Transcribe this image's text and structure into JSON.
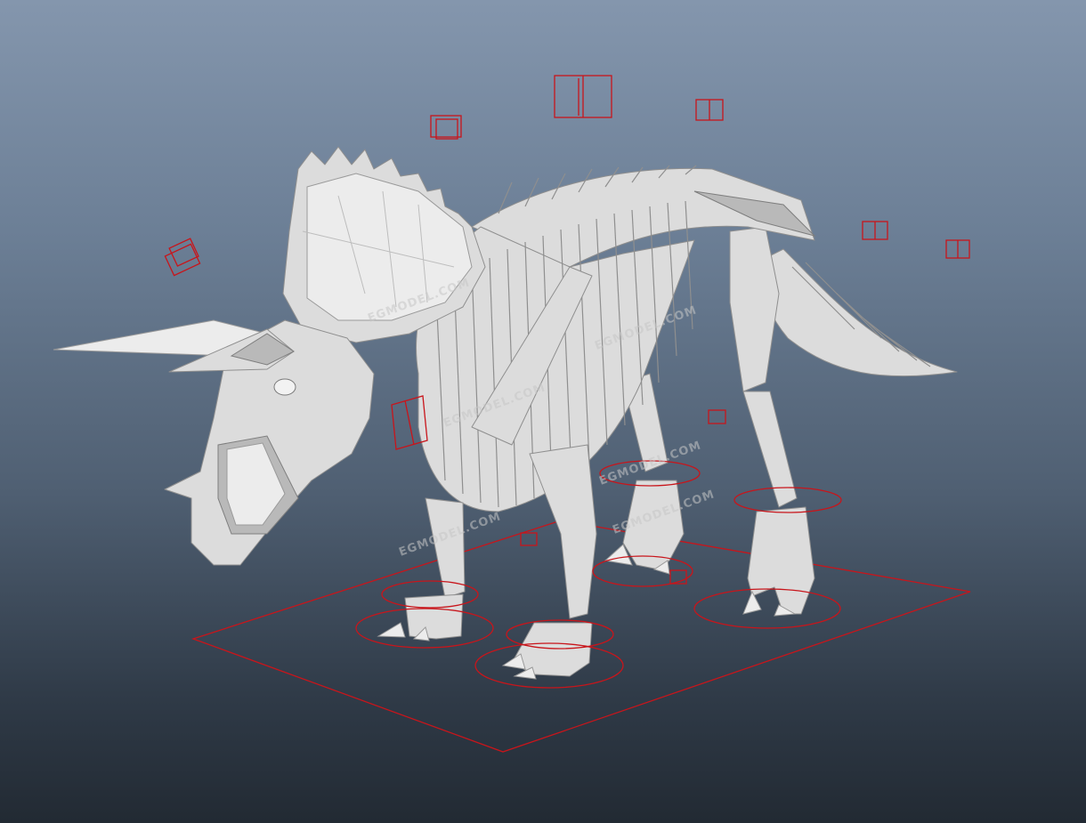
{
  "viewport": {
    "background_top": "#8496ad",
    "background_bottom": "#222a33",
    "model": "triceratops-skeleton",
    "control_color": "#c8151b",
    "bone_color": "#dcdcdc"
  },
  "watermarks": [
    "EGMODEL.COM",
    "EGMODEL.COM",
    "EGMODEL.COM",
    "EGMODEL.COM",
    "EGMODEL.COM",
    "EGMODEL.COM"
  ]
}
